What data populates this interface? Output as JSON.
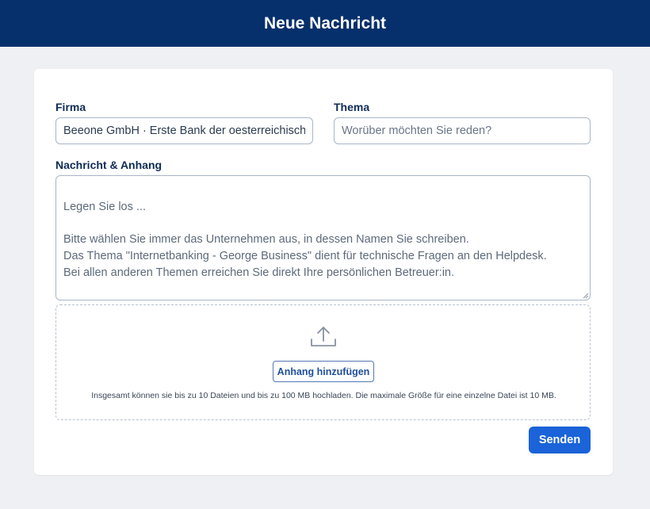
{
  "header": {
    "title": "Neue Nachricht"
  },
  "form": {
    "firma_label": "Firma",
    "firma_value": "Beeone GmbH · Erste Bank der oesterreichischen Sparkassen AG",
    "thema_label": "Thema",
    "thema_placeholder": "Worüber möchten Sie reden?",
    "message_label": "Nachricht & Anhang",
    "message_placeholder": "Legen Sie los ...\n\nBitte wählen Sie immer das Unternehmen aus, in dessen Namen Sie schreiben.\nDas Thema \"Internetbanking - George Business\" dient für technische Fragen an den Helpdesk.\nBei allen anderen Themen erreichen Sie direkt Ihre persönlichen Betreuer:in."
  },
  "attachment": {
    "icon": "upload-icon",
    "button_label": "Anhang hinzufügen",
    "hint": "Insgesamt können sie bis zu 10 Dateien und bis zu 100 MB hochladen. Die maximale Größe für eine einzelne Datei ist 10 MB."
  },
  "actions": {
    "send_label": "Senden"
  },
  "colors": {
    "header_bg": "#05306b",
    "primary": "#1a63d8",
    "page_bg": "#eef0f3"
  }
}
